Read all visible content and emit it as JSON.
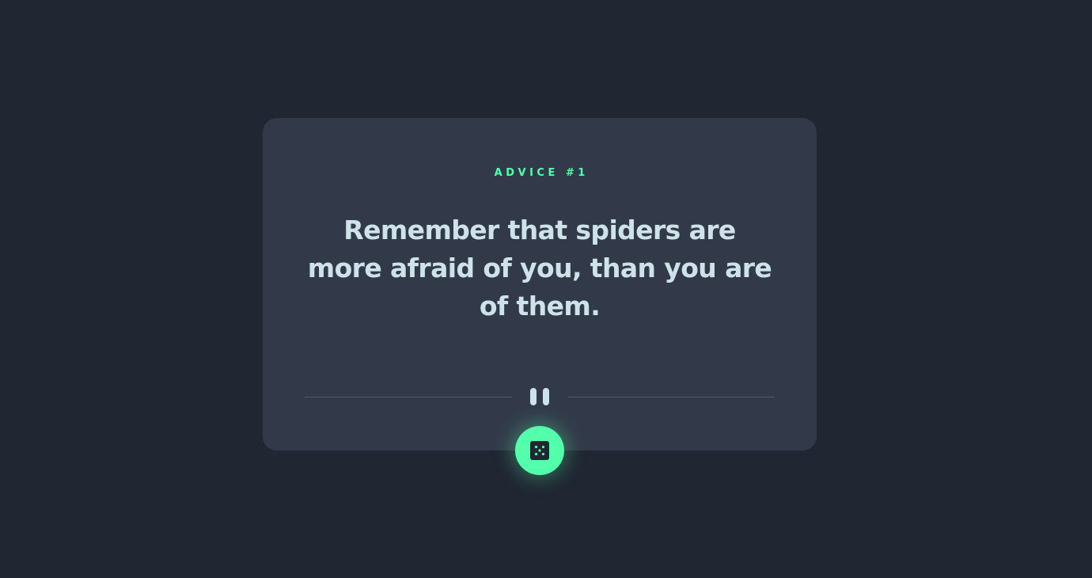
{
  "advice": {
    "label": "ADVICE #1",
    "text": "Remember that spiders are more afraid of you, than you are of them."
  },
  "divider": {
    "icon": "pause-icon"
  },
  "dice_button": {
    "icon": "dice-icon"
  },
  "colors": {
    "background": "#202632",
    "card": "#323a49",
    "accent": "#53ffaa",
    "text": "#cee3e9",
    "divider": "#4f5b70"
  }
}
